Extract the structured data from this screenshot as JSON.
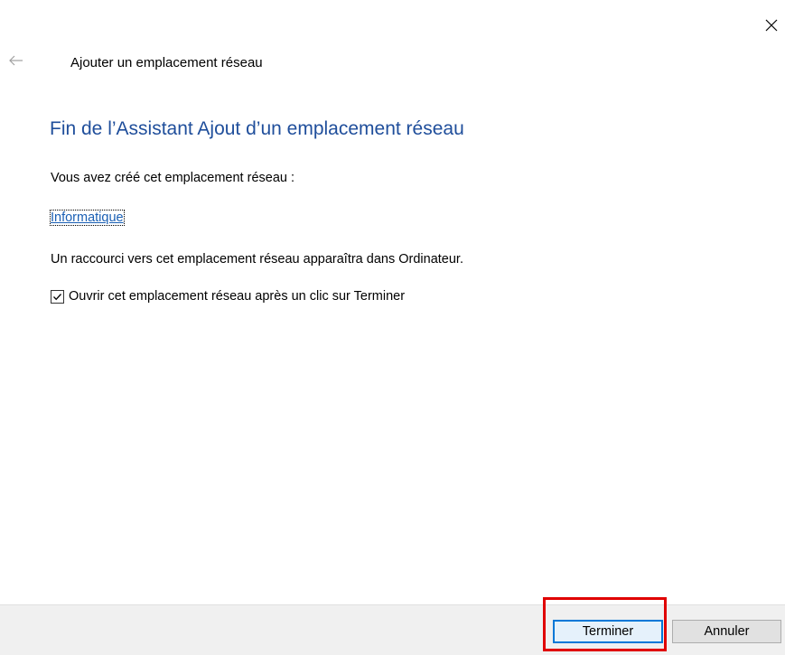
{
  "window": {
    "title": "Ajouter un emplacement réseau"
  },
  "icons": {
    "close": "close-icon",
    "back": "back-arrow-icon",
    "checkmark": "checkmark-icon"
  },
  "content": {
    "heading": "Fin de l’Assistant Ajout d’un emplacement réseau",
    "created_label": "Vous avez créé cet emplacement réseau :",
    "location_name": "Informatique",
    "shortcut_info": "Un raccourci vers cet emplacement réseau apparaîtra dans Ordinateur.",
    "open_checkbox": {
      "label": "Ouvrir cet emplacement réseau après un clic sur Terminer",
      "checked": true
    }
  },
  "footer": {
    "finish_label": "Terminer",
    "cancel_label": "Annuler"
  },
  "colors": {
    "heading": "#1f4e9b",
    "link": "#1a5fb4",
    "highlight": "#e00000",
    "footer_bg": "#f0f0f0",
    "default_button_border": "#0078d7"
  }
}
